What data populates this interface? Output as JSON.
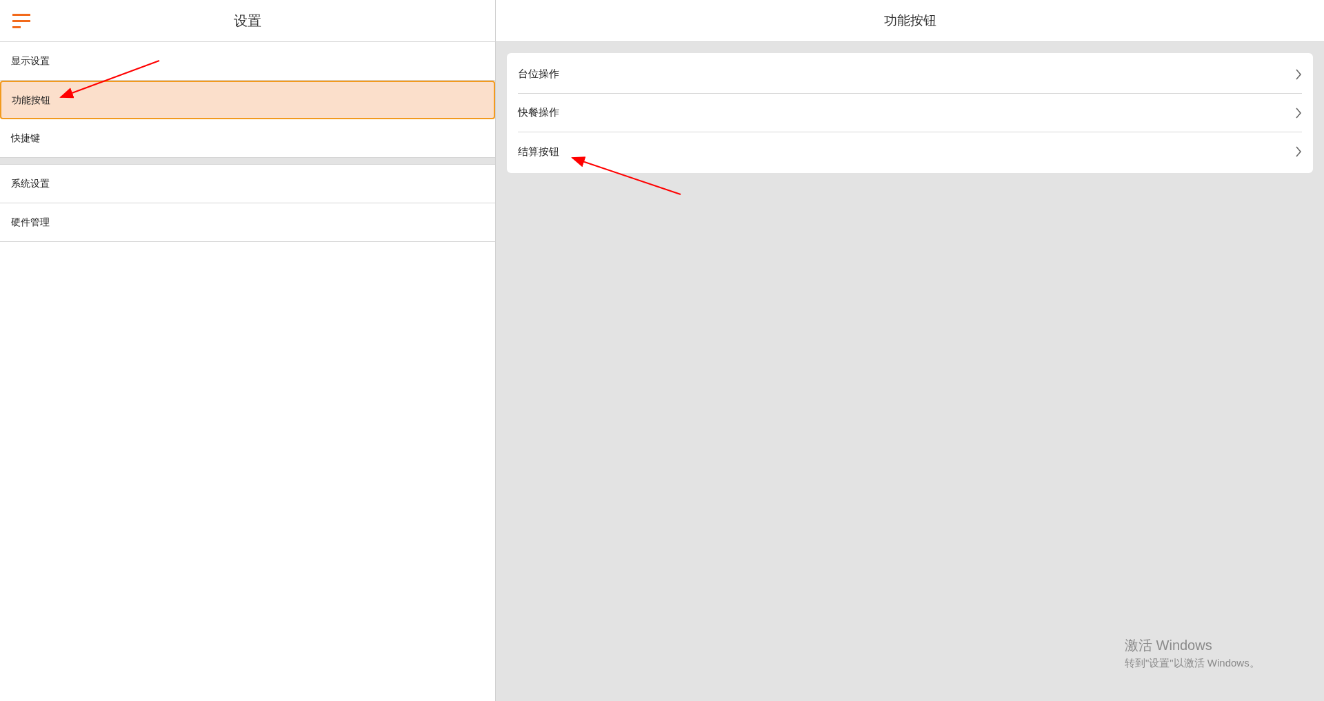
{
  "sidebar": {
    "title": "设置",
    "groups": [
      [
        {
          "label": "显示设置",
          "selected": false
        },
        {
          "label": "功能按钮",
          "selected": true
        },
        {
          "label": "快捷键",
          "selected": false
        }
      ],
      [
        {
          "label": "系统设置",
          "selected": false
        },
        {
          "label": "硬件管理",
          "selected": false
        }
      ]
    ]
  },
  "main": {
    "title": "功能按钮",
    "items": [
      {
        "label": "台位操作"
      },
      {
        "label": "快餐操作"
      },
      {
        "label": "结算按钮"
      }
    ]
  },
  "system_notice": {
    "title": "激活 Windows",
    "text": "转到\"设置\"以激活 Windows。"
  }
}
